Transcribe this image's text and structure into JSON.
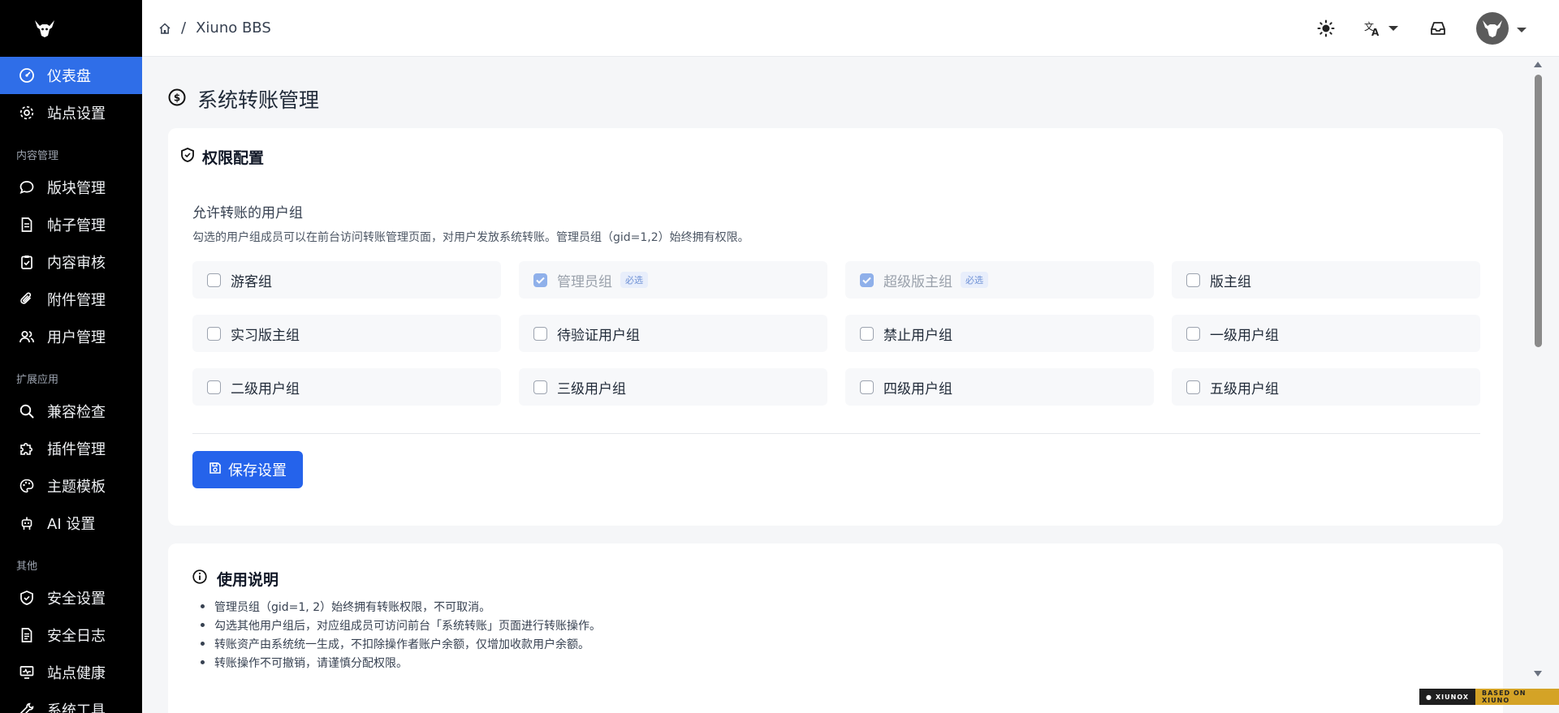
{
  "sidebar": {
    "items": [
      {
        "label": "仪表盘",
        "icon": "dashboard-icon",
        "active": true
      },
      {
        "label": "站点设置",
        "icon": "gear-icon"
      },
      {
        "section": "内容管理"
      },
      {
        "label": "版块管理",
        "icon": "chat-bubble-icon"
      },
      {
        "label": "帖子管理",
        "icon": "document-icon"
      },
      {
        "label": "内容审核",
        "icon": "clipboard-check-icon"
      },
      {
        "label": "附件管理",
        "icon": "paperclip-icon"
      },
      {
        "label": "用户管理",
        "icon": "users-icon"
      },
      {
        "section": "扩展应用"
      },
      {
        "label": "兼容检查",
        "icon": "search-icon"
      },
      {
        "label": "插件管理",
        "icon": "puzzle-icon"
      },
      {
        "label": "主题模板",
        "icon": "palette-icon"
      },
      {
        "label": "AI 设置",
        "icon": "robot-icon"
      },
      {
        "section": "其他"
      },
      {
        "label": "安全设置",
        "icon": "shield-icon"
      },
      {
        "label": "安全日志",
        "icon": "log-document-icon"
      },
      {
        "label": "站点健康",
        "icon": "monitor-icon"
      },
      {
        "label": "系统工具",
        "icon": "tools-icon"
      }
    ]
  },
  "breadcrumb": {
    "site": "Xiuno BBS"
  },
  "page": {
    "title": "系统转账管理"
  },
  "permissions": {
    "header": "权限配置",
    "field_label": "允许转账的用户组",
    "help": "勾选的用户组成员可以在前台访问转账管理页面，对用户发放系统转账。管理员组（gid=1,2）始终拥有权限。",
    "required_badge": "必选",
    "groups": [
      {
        "label": "游客组",
        "checked": false,
        "required": false
      },
      {
        "label": "管理员组",
        "checked": true,
        "required": true
      },
      {
        "label": "超级版主组",
        "checked": true,
        "required": true
      },
      {
        "label": "版主组",
        "checked": false,
        "required": false
      },
      {
        "label": "实习版主组",
        "checked": false,
        "required": false
      },
      {
        "label": "待验证用户组",
        "checked": false,
        "required": false
      },
      {
        "label": "禁止用户组",
        "checked": false,
        "required": false
      },
      {
        "label": "一级用户组",
        "checked": false,
        "required": false
      },
      {
        "label": "二级用户组",
        "checked": false,
        "required": false
      },
      {
        "label": "三级用户组",
        "checked": false,
        "required": false
      },
      {
        "label": "四级用户组",
        "checked": false,
        "required": false
      },
      {
        "label": "五级用户组",
        "checked": false,
        "required": false
      }
    ],
    "save_label": "保存设置"
  },
  "usage": {
    "header": "使用说明",
    "items": [
      "管理员组（gid=1, 2）始终拥有转账权限，不可取消。",
      "勾选其他用户组后，对应组成员可访问前台「系统转账」页面进行转账操作。",
      "转账资产由系统统一生成，不扣除操作者账户余额，仅增加收款用户余额。",
      "转账操作不可撤销，请谨慎分配权限。"
    ]
  },
  "footer": {
    "left": "XIUNOX",
    "right": "BASED ON XIUNO"
  },
  "colors": {
    "accent": "#2563eb",
    "sidebar_bg": "#000000",
    "active_item": "#2f6ee8"
  }
}
